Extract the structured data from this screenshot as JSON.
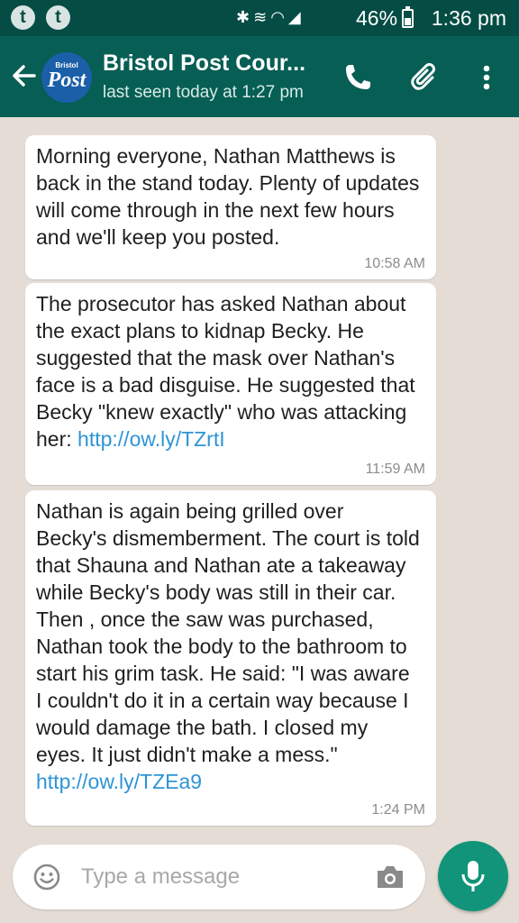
{
  "status_bar": {
    "notification_icons": [
      "t",
      "t"
    ],
    "battery": "46%",
    "battery_level": 0.46,
    "time": "1:36 pm",
    "system_icons": [
      "bluetooth-icon",
      "vibrate-icon",
      "wifi-icon",
      "signal-icon",
      "battery-icon"
    ]
  },
  "header": {
    "title": "Bristol Post Cour...",
    "subtitle": "last seen today at 1:27 pm",
    "avatar": {
      "small_text": "Bristol",
      "big_text": "Post"
    },
    "actions": [
      "phone-icon",
      "paperclip-icon",
      "more-vert-icon"
    ],
    "bar_color": "#075e54",
    "status_color": "#054d44"
  },
  "messages": [
    {
      "text": "Morning everyone, Nathan Matthews is back in the stand today. Plenty of updates will come through in the next few hours and we'll keep you posted.",
      "link": "",
      "time": "10:58 AM"
    },
    {
      "text": "The prosecutor has asked Nathan about the exact plans to kidnap Becky. He suggested that the mask over Nathan's face is a bad disguise. He suggested that Becky \"knew exactly\" who was attacking her: ",
      "link": "http://ow.ly/TZrtI",
      "time": "11:59 AM"
    },
    {
      "text": "Nathan is again being grilled over Becky's dismemberment. The court is told that Shauna and Nathan ate a takeaway while Becky's body was still in their car. Then , once the saw was purchased, Nathan took the body to the bathroom to start his grim task. He said: \"I was aware I couldn't do it in a certain way because I would damage the bath. I closed my eyes. It just didn't make a mess.\" ",
      "link": "http://ow.ly/TZEa9",
      "time": "1:24 PM"
    }
  ],
  "composer": {
    "placeholder": "Type a message",
    "value": ""
  },
  "colors": {
    "link": "#2e94d6",
    "fab": "#119479",
    "chat_bg": "#e5ddd5"
  }
}
